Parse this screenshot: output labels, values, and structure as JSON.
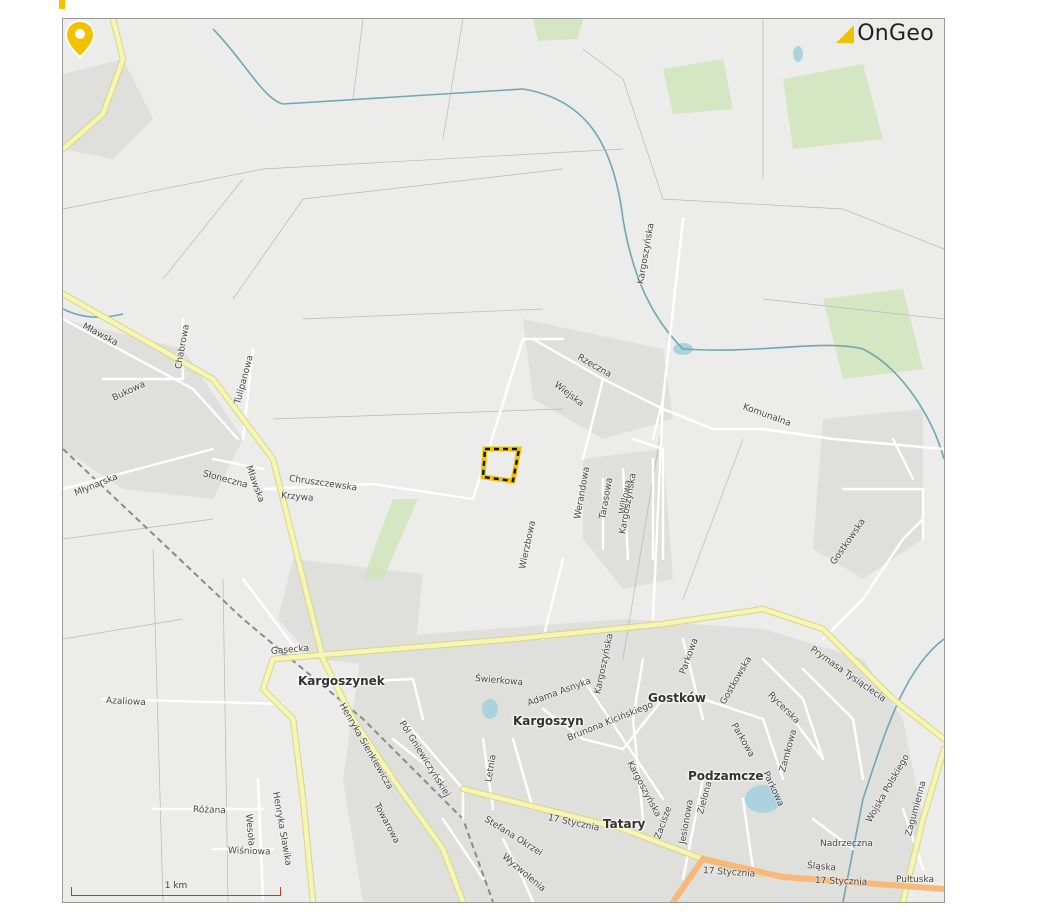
{
  "brand": {
    "name": "OnGeo",
    "accent_color": "#f2c200"
  },
  "colors": {
    "map_bg": "#ecedea",
    "road_major": "#f6f6b4",
    "road_major_edge": "#d9d48a",
    "road_trunk": "#f7b87a",
    "road_minor": "#ffffff",
    "water": "#aad3df",
    "river": "#6fa8b3",
    "residential": "#dfdfdc",
    "green": "#cfe3b8",
    "rail": "#8a8a8a",
    "parcel_outline": "#111111"
  },
  "places": {
    "kargoszynek": "Kargoszynek",
    "kargoszyn": "Kargoszyn",
    "gostkow": "Gostków",
    "podzamcze": "Podzamcze",
    "tatary": "Tatary"
  },
  "streets": {
    "mlawska_nw": "Mławska",
    "chabrowa": "Chabrowa",
    "tulipanowa": "Tulipanowa",
    "bukowa": "Bukowa",
    "mlawska_mid": "Mławska",
    "sloneczna": "Słoneczna",
    "mlynarska": "Młynarska",
    "krzywa": "Krzywa",
    "chruszczewska": "Chruszczewska",
    "rzeczna": "Rzeczna",
    "wiejska": "Wiejska",
    "kargoszynska_n": "Kargoszyńska",
    "komunalna": "Komunalna",
    "werandowa": "Werandowa",
    "tarasowa": "Tarasowa",
    "willowa": "Willowa",
    "kargoszynska_mid": "Kargoszyńska",
    "wierzbowa": "Wierzbowa",
    "gostkowska": "Gostkowska",
    "prymasa": "Prymasa Tysiąclecia",
    "gasecka": "Gąsecka",
    "swierkowa": "Świerkowa",
    "adama_asnyka": "Adama Asnyka",
    "kargoszynska_s": "Kargoszyńska",
    "parkowa_n": "Parkowa",
    "gostkowska_s": "Gostkowska",
    "rycerska": "Rycerska",
    "azaliowa": "Azaliowa",
    "henryka_sienkiewicza": "Henryka Sienkiewicza",
    "pol_gniewiczynskiej": "Pól Gniewiczyńskiej",
    "brunona_kicinskiego": "Brunona Kicińskiego",
    "parkowa_mid": "Parkowa",
    "zamkowa": "Zamkowa",
    "parkowa_s": "Parkowa",
    "letnia": "Letnia",
    "kargoszynska_ss": "Kargoszyńska",
    "rozana": "Różana",
    "wesola": "Wesoła",
    "henryka_slawika": "Henryka Sławika",
    "towarowa": "Towarowa",
    "stefana_okrzei": "Stefana Okrzei",
    "17_stycznia_w": "17 Stycznia",
    "zacisze": "Zacisze",
    "jesionowa": "Jesionowa",
    "zielona": "Zielona",
    "wisniowa": "Wiśniowa",
    "wyzwolenia": "Wyzwolenia",
    "17_stycznia_mid": "17 Stycznia",
    "17_stycznia_e": "17 Stycznia",
    "pultuska": "Pułtuska",
    "nadrzeczna": "Nadrzeczna",
    "slaska": "Śląska",
    "wojska_polskiego": "Wojska Polskiego",
    "zagumienna": "Zagumienna"
  },
  "scale_bar": {
    "label": "1 km"
  },
  "marker": {
    "icon": "location-pin-icon",
    "parcel": "parcel-outline"
  }
}
